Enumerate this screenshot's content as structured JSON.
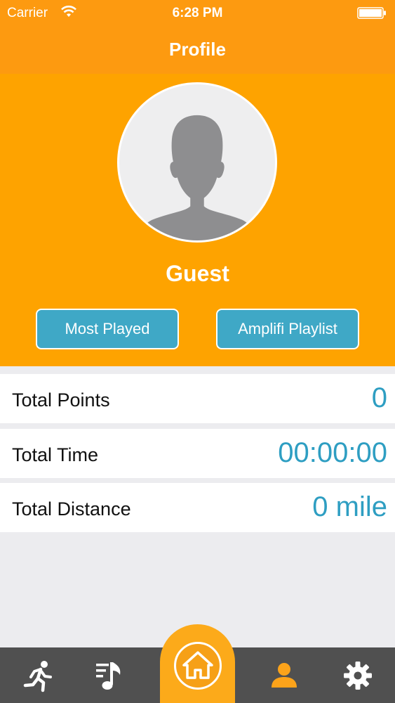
{
  "status_bar": {
    "carrier": "Carrier",
    "time": "6:28 PM"
  },
  "nav": {
    "title": "Profile"
  },
  "profile": {
    "name": "Guest",
    "buttons": {
      "most_played": "Most Played",
      "playlist": "Amplifi Playlist"
    }
  },
  "stats": [
    {
      "label": "Total Points",
      "value": "0"
    },
    {
      "label": "Total Time",
      "value": "00:00:00"
    },
    {
      "label": "Total Distance",
      "value": "0 mile"
    }
  ],
  "tabs": [
    {
      "icon": "running-icon"
    },
    {
      "icon": "music-list-icon"
    },
    {
      "icon": "home-icon",
      "active": true
    },
    {
      "icon": "profile-icon",
      "active": true
    },
    {
      "icon": "gear-icon"
    }
  ],
  "colors": {
    "header_orange": "#fea300",
    "nav_orange": "#fd9a10",
    "accent_blue": "#3fa8c6",
    "value_blue": "#2e9ec2",
    "tab_bar": "#505050",
    "active_tab": "#fca31a"
  }
}
